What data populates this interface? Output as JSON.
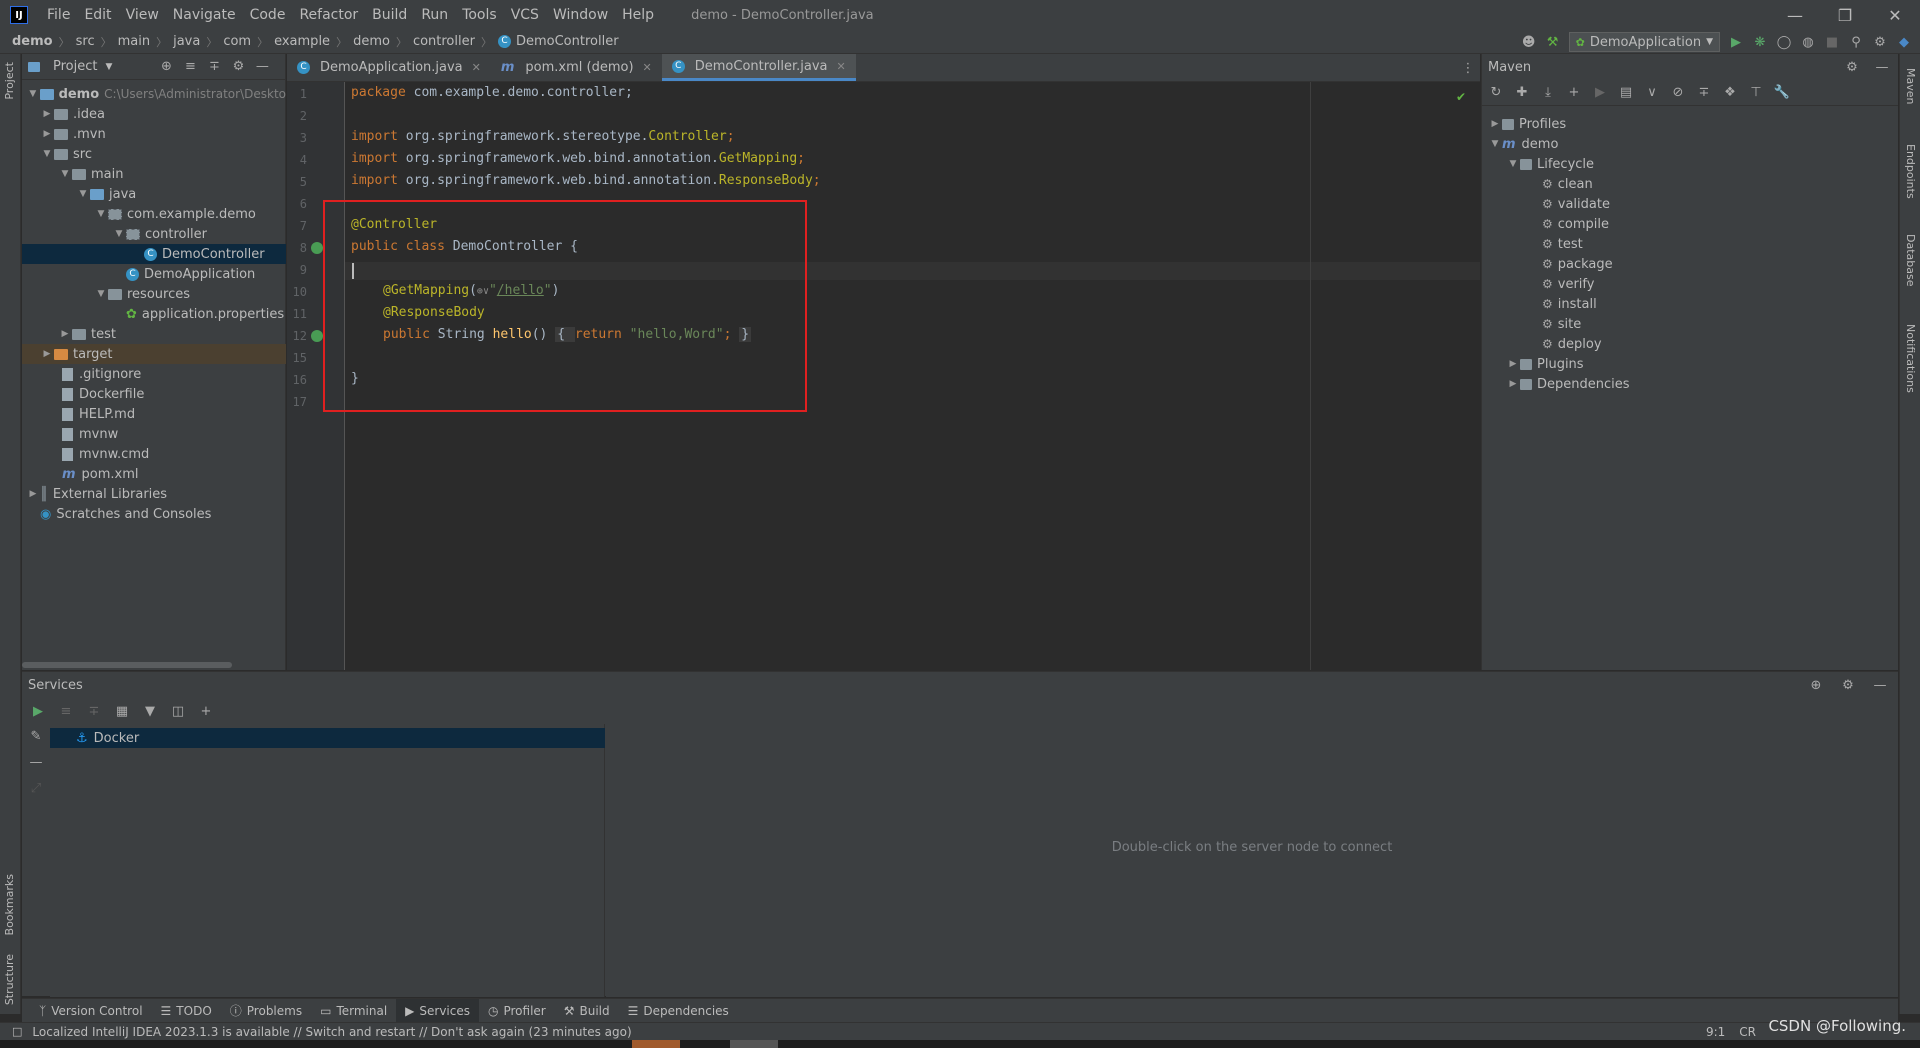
{
  "menubar": {
    "logo": "IJ",
    "items": [
      {
        "label": "File",
        "mnemonic": "F"
      },
      {
        "label": "Edit",
        "mnemonic": "E"
      },
      {
        "label": "View",
        "mnemonic": "V"
      },
      {
        "label": "Navigate",
        "mnemonic": "N"
      },
      {
        "label": "Code",
        "mnemonic": "C"
      },
      {
        "label": "Refactor",
        "mnemonic": "R"
      },
      {
        "label": "Build",
        "mnemonic": "B"
      },
      {
        "label": "Run",
        "mnemonic": "u"
      },
      {
        "label": "Tools",
        "mnemonic": "T"
      },
      {
        "label": "VCS",
        "mnemonic": "S"
      },
      {
        "label": "Window",
        "mnemonic": "W"
      },
      {
        "label": "Help",
        "mnemonic": "H"
      }
    ],
    "window_title": "demo - DemoController.java"
  },
  "breadcrumb": [
    "demo",
    "src",
    "main",
    "java",
    "com",
    "example",
    "demo",
    "controller",
    "DemoController"
  ],
  "run_config": "DemoApplication",
  "left_strip": {
    "project": "Project",
    "bookmarks": "Bookmarks",
    "structure": "Structure"
  },
  "right_strip": {
    "maven": "Maven",
    "endpoints": "Endpoints",
    "database": "Database",
    "notifications": "Notifications"
  },
  "project": {
    "title": "Project",
    "root_path": "C:\\Users\\Administrator\\Deskto",
    "tree": [
      {
        "label": "demo",
        "kind": "module"
      },
      {
        "label": ".idea",
        "kind": "folder"
      },
      {
        "label": ".mvn",
        "kind": "folder"
      },
      {
        "label": "src",
        "kind": "folder"
      },
      {
        "label": "main",
        "kind": "folder"
      },
      {
        "label": "java",
        "kind": "source-folder"
      },
      {
        "label": "com.example.demo",
        "kind": "package"
      },
      {
        "label": "controller",
        "kind": "package"
      },
      {
        "label": "DemoController",
        "kind": "class"
      },
      {
        "label": "DemoApplication",
        "kind": "spring-class"
      },
      {
        "label": "resources",
        "kind": "resources-folder"
      },
      {
        "label": "application.properties",
        "kind": "properties"
      },
      {
        "label": "test",
        "kind": "folder"
      },
      {
        "label": "target",
        "kind": "excluded-folder"
      },
      {
        "label": ".gitignore",
        "kind": "file"
      },
      {
        "label": "Dockerfile",
        "kind": "file"
      },
      {
        "label": "HELP.md",
        "kind": "file"
      },
      {
        "label": "mvnw",
        "kind": "file"
      },
      {
        "label": "mvnw.cmd",
        "kind": "file"
      },
      {
        "label": "pom.xml",
        "kind": "maven"
      },
      {
        "label": "External Libraries",
        "kind": "libraries"
      },
      {
        "label": "Scratches and Consoles",
        "kind": "scratches"
      }
    ]
  },
  "editor": {
    "tabs": [
      {
        "label": "DemoApplication.java",
        "active": false
      },
      {
        "label": "pom.xml (demo)",
        "active": false
      },
      {
        "label": "DemoController.java",
        "active": true
      }
    ],
    "line_numbers": [
      "1",
      "2",
      "3",
      "4",
      "5",
      "6",
      "7",
      "8",
      "9",
      "10",
      "11",
      "12",
      "15",
      "16",
      "17"
    ],
    "code": {
      "l1_kw": "package",
      "l1_rest": " com.example.demo.controller;",
      "l3_kw": "import",
      "l3_pkg": " org.springframework.stereotype.",
      "l3_cls": "Controller",
      "l4_kw": "import",
      "l4_pkg": " org.springframework.web.bind.annotation.",
      "l4_cls": "GetMapping",
      "l5_kw": "import",
      "l5_pkg": " org.springframework.web.bind.annotation.",
      "l5_cls": "ResponseBody",
      "semicolon": ";",
      "l7": "@Controller",
      "l8_kw": "public class",
      "l8_rest": " DemoController {",
      "l10_ann": "@GetMapping",
      "l10_open": "(",
      "l10_icon": "⊕∨",
      "l10_q1": "\"",
      "l10_url": "/hello",
      "l10_q2": "\"",
      "l10_close": ")",
      "l11": "@ResponseBody",
      "l12_kw": "public",
      "l12_type": " String ",
      "l12_fn": "hello",
      "l12_paren": "() ",
      "l12_fold_open": "{ ",
      "l12_ret": "return",
      "l12_str": " \"hello,Word\"",
      "l12_semi": "; ",
      "l12_fold_close": "}",
      "l16": "}"
    }
  },
  "maven": {
    "title": "Maven",
    "tree": [
      {
        "label": "Profiles"
      },
      {
        "label": "demo"
      },
      {
        "label": "Lifecycle"
      },
      {
        "label": "clean"
      },
      {
        "label": "validate"
      },
      {
        "label": "compile"
      },
      {
        "label": "test"
      },
      {
        "label": "package"
      },
      {
        "label": "verify"
      },
      {
        "label": "install"
      },
      {
        "label": "site"
      },
      {
        "label": "deploy"
      },
      {
        "label": "Plugins"
      },
      {
        "label": "Dependencies"
      }
    ]
  },
  "services": {
    "title": "Services",
    "docker": "Docker",
    "empty_message": "Double-click on the server node to connect"
  },
  "bottom_tabs": [
    {
      "label": "Version Control",
      "active": false
    },
    {
      "label": "TODO",
      "active": false
    },
    {
      "label": "Problems",
      "active": false
    },
    {
      "label": "Terminal",
      "active": false
    },
    {
      "label": "Services",
      "active": true
    },
    {
      "label": "Profiler",
      "active": false
    },
    {
      "label": "Build",
      "active": false
    },
    {
      "label": "Dependencies",
      "active": false
    }
  ],
  "status": {
    "message": "Localized IntelliJ IDEA 2023.1.3 is available // Switch and restart // Don't ask again (23 minutes ago)",
    "position": "9:1",
    "encoding": "CR",
    "watermark": "CSDN @Following."
  },
  "colors": {
    "accent": "#4a88c7",
    "highlight_box": "#e02020",
    "selection": "#0d293e"
  }
}
